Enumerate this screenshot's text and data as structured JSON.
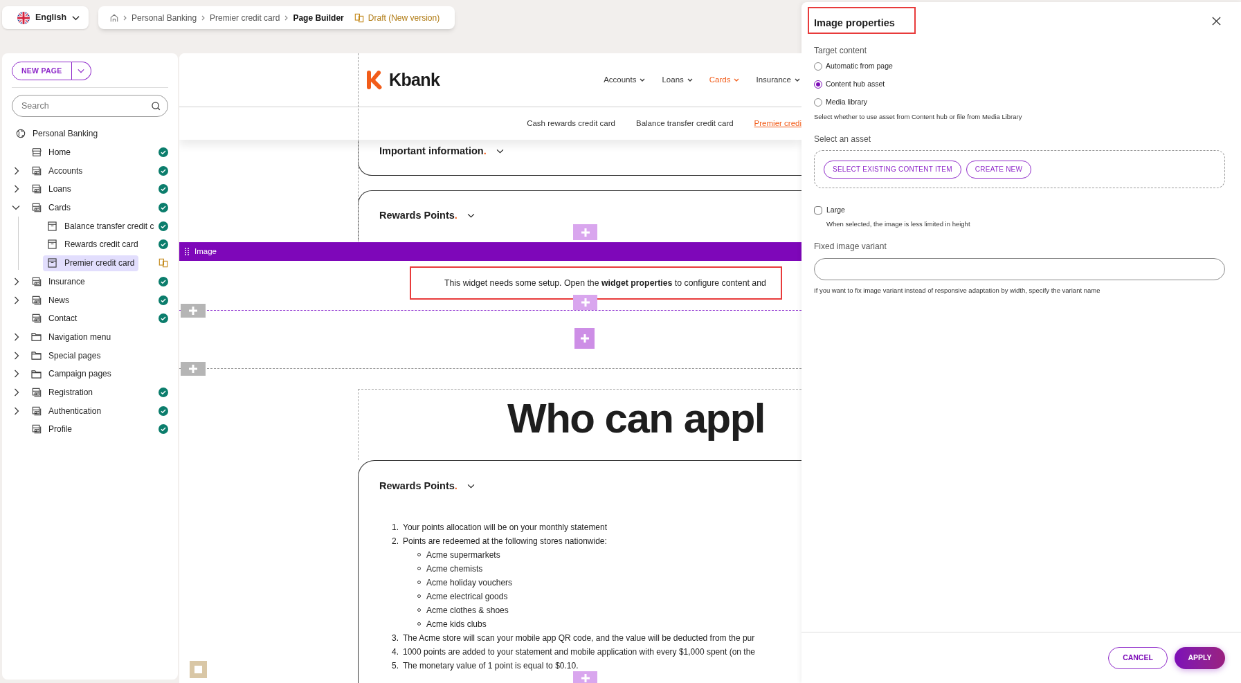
{
  "language": {
    "label": "English"
  },
  "breadcrumb": {
    "items": [
      {
        "label": "Personal Banking",
        "current": false
      },
      {
        "label": "Premier credit card",
        "current": false
      },
      {
        "label": "Page Builder",
        "current": true
      }
    ],
    "status": "Draft (New version)"
  },
  "sidebar": {
    "new_page_button": "NEW PAGE",
    "search": {
      "placeholder": "Search"
    },
    "tree": [
      {
        "label": "Personal Banking",
        "kind": "site",
        "selected": false,
        "children": [
          {
            "label": "Home",
            "kind": "home",
            "published": true,
            "draft": false,
            "selected": false
          },
          {
            "label": "Accounts",
            "kind": "section",
            "published": true,
            "draft": false,
            "expanded": false,
            "selected": false
          },
          {
            "label": "Loans",
            "kind": "section",
            "published": true,
            "draft": false,
            "expanded": false,
            "selected": false
          },
          {
            "label": "Cards",
            "kind": "section",
            "published": true,
            "draft": false,
            "expanded": true,
            "selected": false,
            "children": [
              {
                "label": "Balance transfer credit c",
                "kind": "page",
                "published": true,
                "draft": false,
                "selected": false
              },
              {
                "label": "Rewards credit card",
                "kind": "page",
                "published": true,
                "draft": false,
                "selected": false
              },
              {
                "label": "Premier credit card",
                "kind": "page",
                "published": false,
                "draft": true,
                "selected": true
              }
            ]
          },
          {
            "label": "Insurance",
            "kind": "section",
            "published": true,
            "draft": false,
            "expanded": false,
            "selected": false
          },
          {
            "label": "News",
            "kind": "section",
            "published": true,
            "draft": false,
            "expanded": false,
            "selected": false
          },
          {
            "label": "Contact",
            "kind": "section",
            "published": true,
            "draft": false,
            "selected": false
          },
          {
            "label": "Navigation menu",
            "kind": "folder",
            "published": false,
            "draft": false,
            "expanded": false,
            "selected": false
          },
          {
            "label": "Special pages",
            "kind": "folder",
            "published": false,
            "draft": false,
            "expanded": false,
            "selected": false
          },
          {
            "label": "Campaign pages",
            "kind": "folder",
            "published": false,
            "draft": false,
            "expanded": false,
            "selected": false
          },
          {
            "label": "Registration",
            "kind": "section",
            "published": true,
            "draft": false,
            "expanded": false,
            "selected": false
          },
          {
            "label": "Authentication",
            "kind": "section",
            "published": true,
            "draft": false,
            "expanded": false,
            "selected": false
          },
          {
            "label": "Profile",
            "kind": "section",
            "published": true,
            "draft": false,
            "selected": false
          }
        ]
      }
    ]
  },
  "canvas": {
    "site_header": {
      "logo": "Kbank",
      "nav": [
        {
          "label": "Accounts",
          "selected": false
        },
        {
          "label": "Loans",
          "selected": false
        },
        {
          "label": "Cards",
          "selected": true
        },
        {
          "label": "Insurance",
          "selected": false
        }
      ],
      "subnav": [
        {
          "label": "Cash rewards credit card",
          "selected": false
        },
        {
          "label": "Balance transfer credit card",
          "selected": false
        },
        {
          "label": "Premier credi",
          "selected": true
        }
      ]
    },
    "accordions_top": [
      {
        "title": "Important information",
        "mark": "."
      },
      {
        "title": "Rewards Points",
        "mark": "."
      }
    ],
    "image_widget": {
      "label": "Image",
      "message": "This widget needs some setup. Open the **widget properties** to configure content and"
    },
    "heading": "Who can appl",
    "rewards": {
      "title": "Rewards Points",
      "mark": ".",
      "items": [
        {
          "number": "1.",
          "text": "Your points allocation will be on your monthly statement"
        },
        {
          "number": "2.",
          "text": "Points are redeemed at the following stores nationwide:",
          "children": [
            {
              "text": "Acme supermarkets"
            },
            {
              "text": "Acme chemists"
            },
            {
              "text": "Acme holiday vouchers"
            },
            {
              "text": "Acme electrical goods"
            },
            {
              "text": "Acme clothes & shoes"
            },
            {
              "text": "Acme kids clubs"
            }
          ]
        },
        {
          "number": "3.",
          "text": "The Acme store will scan your mobile app QR code, and the value will be deducted from the pur"
        },
        {
          "number": "4.",
          "text": "1000 points are added to your statement and mobile application with every $1,000 spent (on the"
        },
        {
          "number": "5.",
          "text": "The monetary value of 1 point is equal to $0.10."
        }
      ]
    }
  },
  "panel": {
    "title": "Image properties",
    "target_content": {
      "label": "Target content",
      "options": [
        {
          "label": "Automatic from page",
          "selected": false
        },
        {
          "label": "Content hub asset",
          "selected": true
        },
        {
          "label": "Media library",
          "selected": false
        }
      ],
      "hint": "Select whether to use asset from Content hub or file from Media Library"
    },
    "asset": {
      "label": "Select an asset",
      "buttons": [
        "SELECT EXISTING CONTENT ITEM",
        "CREATE NEW"
      ]
    },
    "large": {
      "label": "Large",
      "checked": false,
      "hint": "When selected, the image is less limited in height"
    },
    "fixed_variant": {
      "label": "Fixed image variant",
      "hint": "If you want to fix image variant instead of responsive adaptation by width, specify the variant name"
    },
    "footer_buttons": [
      {
        "label": "CANCEL",
        "kind": "secondary"
      },
      {
        "label": "APPLY",
        "kind": "primary"
      }
    ]
  }
}
